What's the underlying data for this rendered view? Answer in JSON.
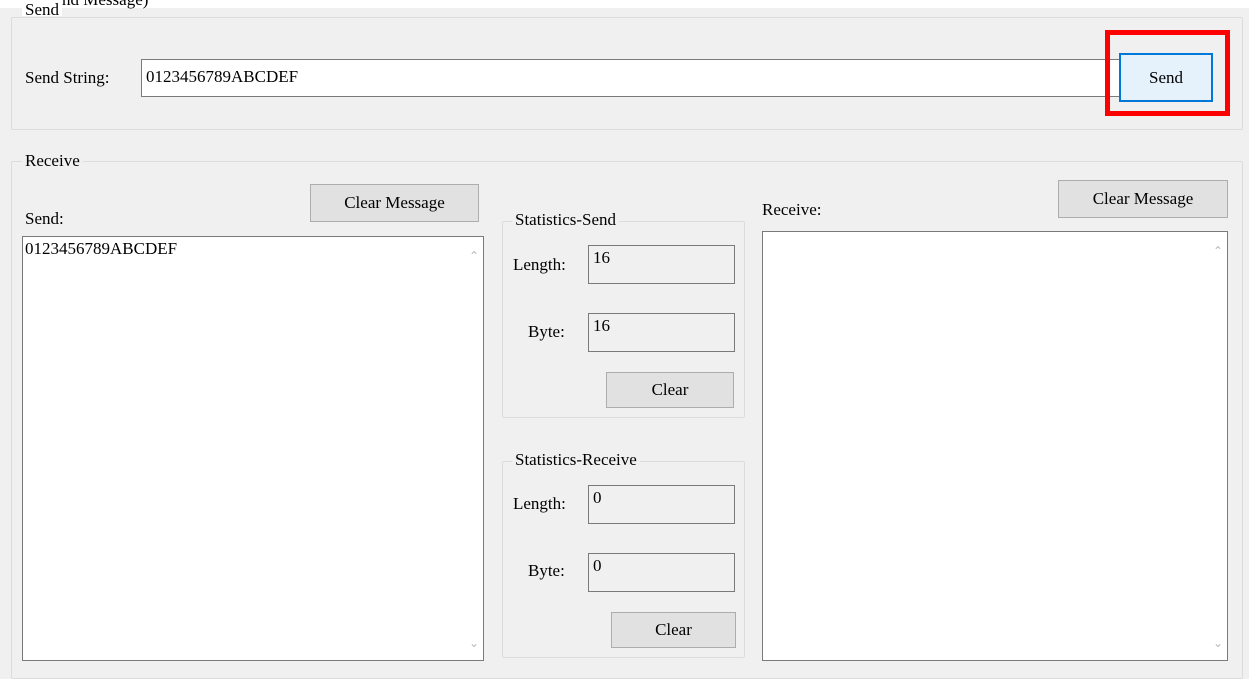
{
  "top_cut_text": "nd Message)",
  "send_group": {
    "legend": "Send",
    "send_string_label": "Send String:",
    "send_string_value": "0123456789ABCDEF",
    "send_button": "Send"
  },
  "receive_group": {
    "legend": "Receive",
    "left": {
      "label": "Send:",
      "clear_button": "Clear Message",
      "content": "0123456789ABCDEF"
    },
    "stats_send": {
      "legend": "Statistics-Send",
      "length_label": "Length:",
      "length_value": "16",
      "byte_label": "Byte:",
      "byte_value": "16",
      "clear_button": "Clear"
    },
    "stats_receive": {
      "legend": "Statistics-Receive",
      "length_label": "Length:",
      "length_value": "0",
      "byte_label": "Byte:",
      "byte_value": "0",
      "clear_button": "Clear"
    },
    "right": {
      "label": "Receive:",
      "clear_button": "Clear Message",
      "content": ""
    }
  },
  "colors": {
    "highlight": "#ff0000",
    "focus_border": "#0078d7",
    "panel_bg": "#f0f0f0"
  },
  "icons": {
    "scroll_up": "chevron-up-icon",
    "scroll_down": "chevron-down-icon"
  }
}
